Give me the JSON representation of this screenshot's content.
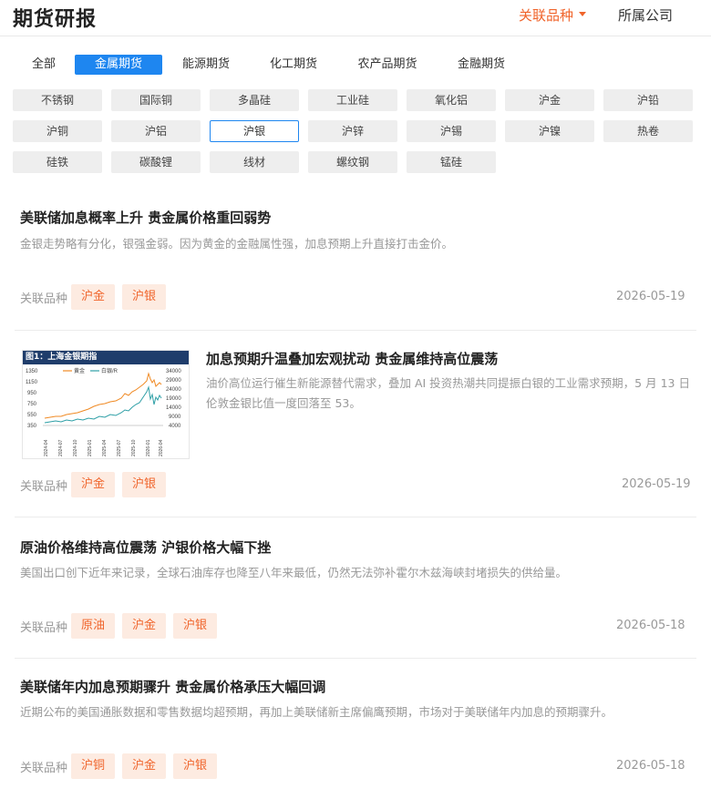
{
  "header": {
    "title": "期货研报",
    "related_filter": "关联品种",
    "company_filter": "所属公司"
  },
  "categories": [
    {
      "label": "全部",
      "active": false
    },
    {
      "label": "金属期货",
      "active": true
    },
    {
      "label": "能源期货",
      "active": false
    },
    {
      "label": "化工期货",
      "active": false
    },
    {
      "label": "农产品期货",
      "active": false
    },
    {
      "label": "金融期货",
      "active": false
    }
  ],
  "products": [
    {
      "label": "不锈钢",
      "selected": false
    },
    {
      "label": "国际铜",
      "selected": false
    },
    {
      "label": "多晶硅",
      "selected": false
    },
    {
      "label": "工业硅",
      "selected": false
    },
    {
      "label": "氧化铝",
      "selected": false
    },
    {
      "label": "沪金",
      "selected": false
    },
    {
      "label": "沪铅",
      "selected": false
    },
    {
      "label": "沪铜",
      "selected": false
    },
    {
      "label": "沪铝",
      "selected": false
    },
    {
      "label": "沪银",
      "selected": true
    },
    {
      "label": "沪锌",
      "selected": false
    },
    {
      "label": "沪锡",
      "selected": false
    },
    {
      "label": "沪镍",
      "selected": false
    },
    {
      "label": "热卷",
      "selected": false
    },
    {
      "label": "硅铁",
      "selected": false
    },
    {
      "label": "碳酸锂",
      "selected": false
    },
    {
      "label": "线材",
      "selected": false
    },
    {
      "label": "螺纹钢",
      "selected": false
    },
    {
      "label": "锰硅",
      "selected": false
    }
  ],
  "related_label": "关联品种",
  "articles": [
    {
      "title": "美联储加息概率上升 贵金属价格重回弱势",
      "summary": "金银走势略有分化，银强金弱。因为黄金的金融属性强，加息预期上升直接打击金价。",
      "tags": [
        "沪金",
        "沪银"
      ],
      "date": "2026-05-19",
      "has_image": false
    },
    {
      "title": "加息预期升温叠加宏观扰动 贵金属维持高位震荡",
      "summary": "油价高位运行催生新能源替代需求，叠加 AI 投资热潮共同提振白银的工业需求预期，5 月 13 日伦敦金银比值一度回落至 53。",
      "tags": [
        "沪金",
        "沪银"
      ],
      "date": "2026-05-19",
      "has_image": true,
      "thumbnail": {
        "title": "图1：上海金银期指",
        "legend": [
          "黄金",
          "白银/R"
        ],
        "y_left_ticks": [
          "1350",
          "1150",
          "950",
          "750",
          "550",
          "350"
        ],
        "y_right_ticks": [
          "34000",
          "29000",
          "24000",
          "19000",
          "14000",
          "9000",
          "4000"
        ],
        "x_ticks": [
          "2024-04",
          "2024-07",
          "2024-10",
          "2025-01",
          "2025-04",
          "2025-07",
          "2025-10",
          "2026-01",
          "2026-04"
        ],
        "colors": {
          "gold": "#f08a24",
          "silver": "#2e9fa6",
          "header": "#1f3d6b"
        }
      }
    },
    {
      "title": "原油价格维持高位震荡 沪银价格大幅下挫",
      "summary": "美国出口创下近年来记录，全球石油库存也降至八年来最低，仍然无法弥补霍尔木兹海峡封堵损失的供给量。",
      "tags": [
        "原油",
        "沪金",
        "沪银"
      ],
      "date": "2026-05-18",
      "has_image": false
    },
    {
      "title": "美联储年内加息预期骤升 贵金属价格承压大幅回调",
      "summary": "近期公布的美国通胀数据和零售数据均超预期，再加上美联储新主席偏鹰预期，市场对于美联储年内加息的预期骤升。",
      "tags": [
        "沪铜",
        "沪金",
        "沪银"
      ],
      "date": "2026-05-18",
      "has_image": false
    }
  ],
  "colors": {
    "accent_blue": "#1e86f0",
    "accent_orange": "#f0642b",
    "tag_bg": "#fdebe1"
  }
}
